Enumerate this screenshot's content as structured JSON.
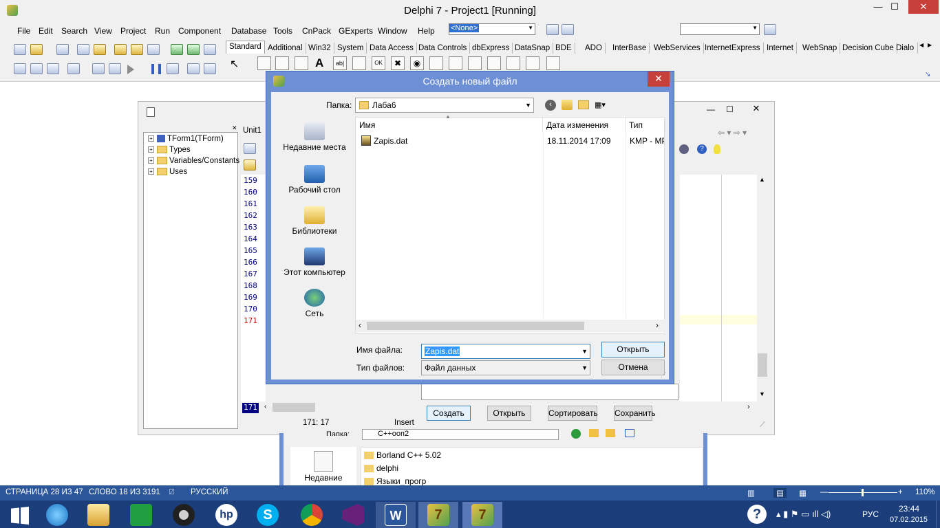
{
  "ide": {
    "title": "Delphi 7 - Project1 [Running]",
    "menu": [
      "File",
      "Edit",
      "Search",
      "View",
      "Project",
      "Run",
      "Component",
      "Database",
      "Tools",
      "CnPack",
      "GExperts",
      "Window",
      "Help"
    ],
    "desktop_combo": "<None>",
    "tabs": [
      "Standard",
      "Additional",
      "Win32",
      "System",
      "Data Access",
      "Data Controls",
      "dbExpress",
      "DataSnap",
      "BDE",
      "ADO",
      "InterBase",
      "WebServices",
      "InternetExpress",
      "Internet",
      "WebSnap",
      "Decision Cube",
      "Dialo"
    ]
  },
  "editor": {
    "tab": "Unit1",
    "tree": [
      "TForm1(TForm)",
      "Types",
      "Variables/Constants",
      "Uses"
    ],
    "line_numbers": [
      "159",
      "160",
      "161",
      "162",
      "163",
      "164",
      "165",
      "166",
      "167",
      "168",
      "169",
      "170",
      "171"
    ],
    "current_line": "171",
    "status_position": "171:  17",
    "status_mode": "Insert",
    "form_buttons": [
      "Создать",
      "Открыть",
      "Сортировать",
      "Сохранить"
    ]
  },
  "dialog": {
    "title": "Создать новый файл",
    "folder_label": "Папка:",
    "folder_value": "Лаба6",
    "places": [
      "Недавние места",
      "Рабочий стол",
      "Библиотеки",
      "Этот компьютер",
      "Сеть"
    ],
    "columns": [
      "Имя",
      "Дата изменения",
      "Тип"
    ],
    "files": [
      {
        "name": "Zapis.dat",
        "date": "18.11.2014 17:09",
        "type": "KMP - MP"
      }
    ],
    "filename_label": "Имя файла:",
    "filename_value": "Zapis.dat",
    "filetype_label": "Тип файлов:",
    "filetype_value": "Файл данных",
    "open_button": "Открыть",
    "cancel_button": "Отмена"
  },
  "bg_dialog": {
    "folder_label": "Папка:",
    "folder_value": "С++ооп2",
    "place": "Недавние",
    "files": [
      "Borland C++ 5.02",
      "delphi",
      "Языки_прогр"
    ]
  },
  "word_status": {
    "page": "СТРАНИЦА 28 ИЗ 47",
    "words": "СЛОВО 18 ИЗ 3191",
    "language": "РУССКИЙ",
    "zoom": "110%"
  },
  "taskbar": {
    "lang": "РУС",
    "time": "23:44",
    "date": "07.02.2015"
  },
  "colors": {
    "dialog_frame": "#6c8fd6",
    "word_bar": "#2b579a",
    "taskbar": "#1b3e7a"
  }
}
